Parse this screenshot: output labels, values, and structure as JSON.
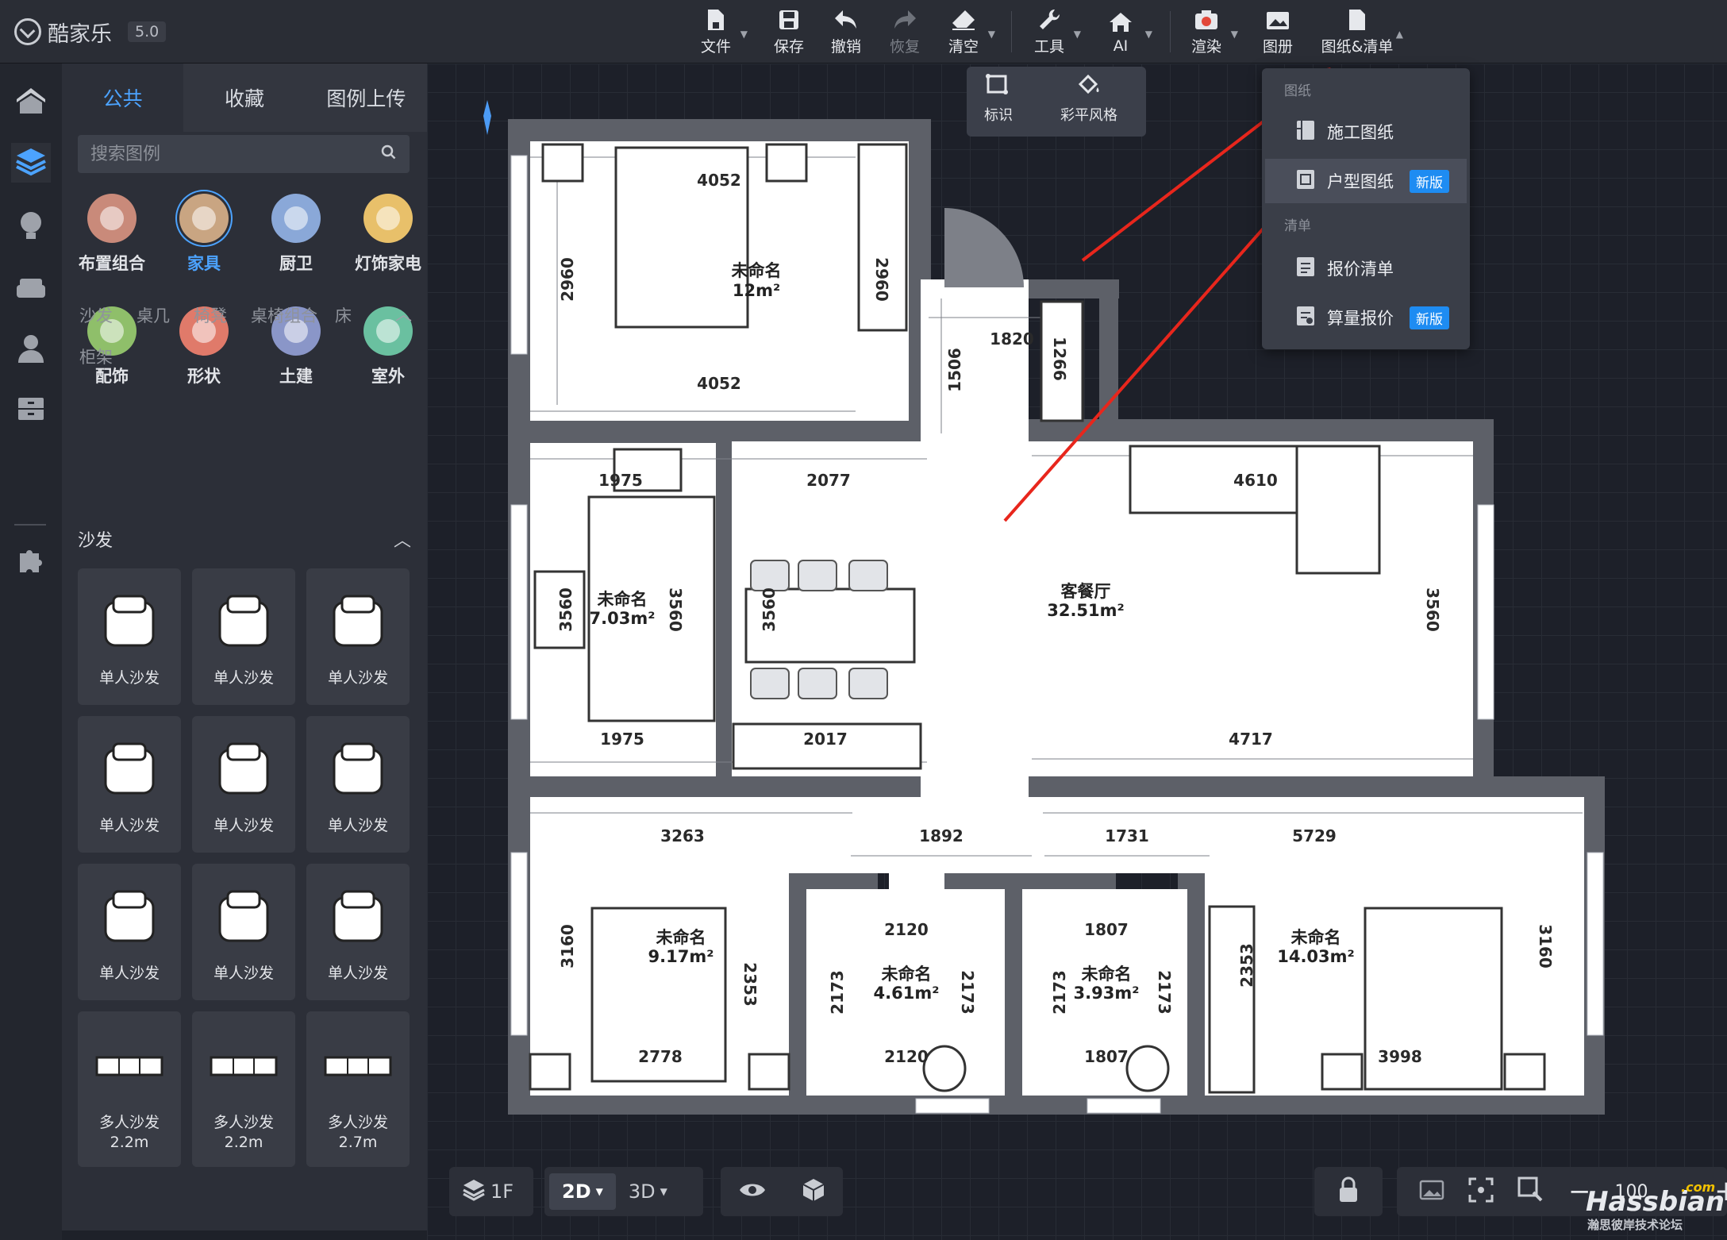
{
  "app": {
    "name": "酷家乐",
    "version": "5.0"
  },
  "toolbar": [
    {
      "label": "文件",
      "icon": "file-icon",
      "dropdown": true
    },
    {
      "label": "保存",
      "icon": "save-icon",
      "dropdown": false
    },
    {
      "label": "撤销",
      "icon": "undo-icon",
      "dropdown": false
    },
    {
      "label": "恢复",
      "icon": "redo-icon",
      "dropdown": false,
      "disabled": true
    },
    {
      "label": "清空",
      "icon": "eraser-icon",
      "dropdown": true
    },
    {
      "label": "工具",
      "icon": "wrench-icon",
      "dropdown": true
    },
    {
      "label": "AI",
      "icon": "ai-house-icon",
      "dropdown": true
    },
    {
      "label": "渲染",
      "icon": "camera-icon",
      "dropdown": true
    },
    {
      "label": "图册",
      "icon": "album-icon",
      "dropdown": false
    },
    {
      "label": "图纸&清单",
      "icon": "drawing-list-icon",
      "dropdown": true
    }
  ],
  "subtoolbar": [
    {
      "label": "标识",
      "icon": "dimension-icon"
    },
    {
      "label": "彩平风格",
      "icon": "paint-bucket-icon"
    }
  ],
  "dropdown_menu": {
    "section_drawings": "图纸",
    "section_lists": "清单",
    "items": [
      {
        "label": "施工图纸",
        "icon": "construction-drawing-icon",
        "badge": ""
      },
      {
        "label": "户型图纸",
        "icon": "floorplan-drawing-icon",
        "badge": "新版"
      },
      {
        "label": "报价清单",
        "icon": "quote-list-icon",
        "badge": ""
      },
      {
        "label": "算量报价",
        "icon": "quantity-quote-icon",
        "badge": "新版"
      }
    ]
  },
  "library": {
    "tabs": [
      "公共",
      "收藏",
      "图例上传"
    ],
    "active_tab": "公共",
    "search_placeholder": "搜索图例",
    "categories": [
      {
        "label": "布置组合",
        "color": "#c98a7a"
      },
      {
        "label": "家具",
        "color": "#c9a582"
      },
      {
        "label": "厨卫",
        "color": "#8aa8d8"
      },
      {
        "label": "灯饰家电",
        "color": "#e8c06a"
      },
      {
        "label": "配饰",
        "color": "#8fbf6a"
      },
      {
        "label": "形状",
        "color": "#e07a6a"
      },
      {
        "label": "土建",
        "color": "#8a96c8"
      },
      {
        "label": "室外",
        "color": "#6ac0a0"
      }
    ],
    "active_category": "家具",
    "subcategories": [
      "沙发",
      "桌几",
      "椅凳",
      "桌椅组合",
      "床",
      "柜架"
    ],
    "section_title": "沙发",
    "items": [
      {
        "label": "单人沙发",
        "size": ""
      },
      {
        "label": "单人沙发",
        "size": ""
      },
      {
        "label": "单人沙发",
        "size": ""
      },
      {
        "label": "单人沙发",
        "size": ""
      },
      {
        "label": "单人沙发",
        "size": ""
      },
      {
        "label": "单人沙发",
        "size": ""
      },
      {
        "label": "单人沙发",
        "size": ""
      },
      {
        "label": "单人沙发",
        "size": ""
      },
      {
        "label": "单人沙发",
        "size": ""
      },
      {
        "label": "多人沙发",
        "size": "2.2m"
      },
      {
        "label": "多人沙发",
        "size": "2.2m"
      },
      {
        "label": "多人沙发",
        "size": "2.7m"
      }
    ]
  },
  "floorplan": {
    "rooms": [
      {
        "name": "未命名",
        "area": "12m²"
      },
      {
        "name": "未命名",
        "area": "7.03m²"
      },
      {
        "name": "客餐厅",
        "area": "32.51m²"
      },
      {
        "name": "未命名",
        "area": "9.17m²"
      },
      {
        "name": "未命名",
        "area": "4.61m²"
      },
      {
        "name": "未命名",
        "area": "3.93m²"
      },
      {
        "name": "未命名",
        "area": "14.03m²"
      }
    ],
    "dimensions": [
      "4052",
      "2960",
      "2960",
      "4052",
      "1820",
      "1506",
      "1266",
      "1975",
      "2077",
      "4610",
      "3560",
      "3560",
      "3560",
      "3560",
      "1975",
      "2017",
      "4717",
      "3263",
      "1892",
      "1731",
      "5729",
      "3160",
      "2353",
      "2120",
      "2173",
      "2173",
      "2120",
      "1807",
      "2173",
      "2173",
      "1807",
      "2353",
      "3160",
      "2778",
      "3998"
    ]
  },
  "bottombar": {
    "floor": "1F",
    "view_2d": "2D",
    "view_3d": "3D",
    "zoom": "100"
  },
  "watermark": {
    "brand": "Hassbian",
    "suffix": ".com",
    "subtitle": "瀚思彼岸技术论坛"
  },
  "colors": {
    "accent": "#4ca3ff",
    "badge": "#1e8cf2",
    "annotation": "#e8261c"
  }
}
